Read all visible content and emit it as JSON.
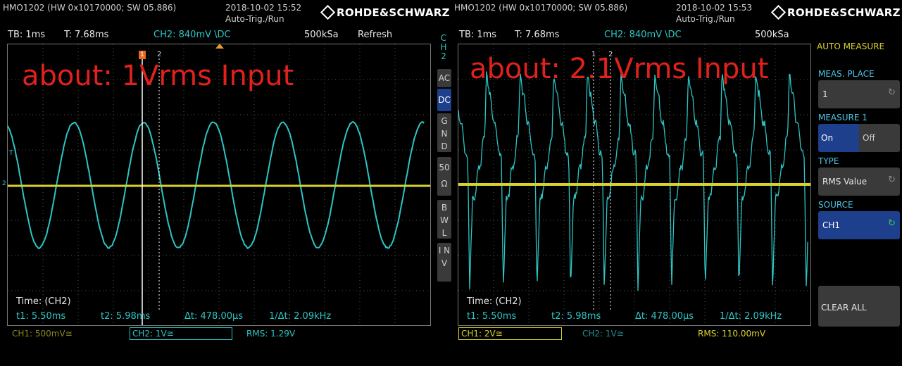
{
  "left_screen": {
    "device": "HMO1202 (HW 0x10170000; SW 05.886)",
    "datetime": "2018-10-02 15:52",
    "trigger_mode": "Auto-Trig./Run",
    "brand": "ROHDE&SCHWARZ",
    "timebase": "TB: 1ms",
    "trigger_time": "T: 7.68ms",
    "channel_setting": "CH2: 840mV \\DC",
    "sample_rate": "500kSa",
    "refresh": "Refresh",
    "annotation": "about: 1Vrms Input",
    "cursor_mode": "Time: (CH2)",
    "t1": "t1: 5.50ms",
    "t2": "t2: 5.98ms",
    "dt": "Δt: 478.00µs",
    "inv_dt": "1/Δt: 2.09kHz",
    "ch1_chip": "CH1: 500mV≅",
    "ch2_chip": "CH2: 1V≅",
    "rms": "RMS: 1.29V",
    "cursor1_label": "1",
    "cursor2_label": "2",
    "trig_marker": "T",
    "level_marker": "2"
  },
  "side_panel": {
    "channel": "C H 2",
    "buttons": [
      "AC",
      "DC",
      "G N D",
      "50 Ω",
      "B W L",
      "I N V"
    ],
    "active_button": "DC"
  },
  "right_screen": {
    "device": "HMO1202 (HW 0x10170000; SW 05.886)",
    "datetime": "2018-10-02 15:53",
    "trigger_mode": "Auto-Trig./Run",
    "brand": "ROHDE&SCHWARZ",
    "timebase": "TB: 1ms",
    "trigger_time": "T: 7.68ms",
    "channel_setting": "CH2: 840mV \\DC",
    "sample_rate": "500kSa",
    "annotation": "about: 2.1Vrms Input",
    "cursor_mode": "Time: (CH2)",
    "t1": "t1: 5.50ms",
    "t2": "t2: 5.98ms",
    "dt": "Δt: 478.00µs",
    "inv_dt": "1/Δt: 2.09kHz",
    "ch1_chip": "CH1: 2V≅",
    "ch2_chip": "CH2: 1V≅",
    "rms": "RMS: 110.00mV",
    "cursor1_label": "1",
    "cursor2_label": "2"
  },
  "auto_measure": {
    "title": "AUTO MEASURE",
    "meas_place_label": "MEAS. PLACE",
    "meas_place_value": "1",
    "measure1_label": "MEASURE 1",
    "on": "On",
    "off": "Off",
    "type_label": "TYPE",
    "type_value": "RMS Value",
    "source_label": "SOURCE",
    "source_value": "CH1",
    "clear_all": "CLEAR ALL"
  },
  "colors": {
    "ch1": "#d9d22a",
    "ch2": "#2ec4c4",
    "annotation": "#e0211c",
    "active": "#1e3f8c"
  },
  "icons": {
    "rotary": "rotary-knob-icon",
    "logo": "rohde-schwarz-logo-icon"
  }
}
